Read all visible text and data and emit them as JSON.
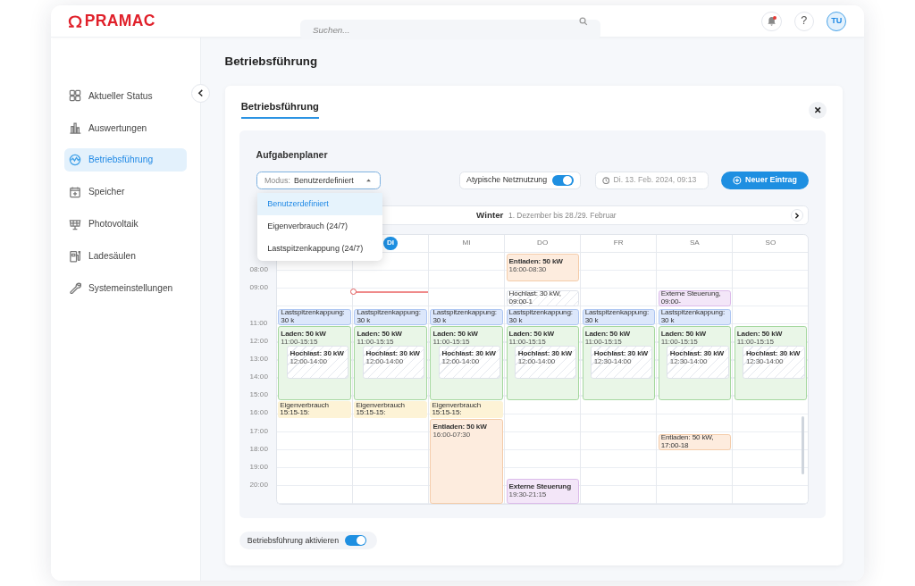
{
  "header": {
    "logo": "PRAMAC",
    "search": {
      "placeholder": "Suchen..."
    },
    "notifications": {
      "unread": true
    },
    "help": "?",
    "avatar": "TU"
  },
  "sidebar": {
    "items": [
      {
        "label": "Aktueller Status",
        "selected": false
      },
      {
        "label": "Auswertungen",
        "selected": false
      },
      {
        "label": "Betriebsführung",
        "selected": true
      },
      {
        "label": "Speicher",
        "selected": false
      },
      {
        "label": "Photovoltaik",
        "selected": false
      },
      {
        "label": "Ladesäulen",
        "selected": false
      },
      {
        "label": "Systemeinstellungen",
        "selected": false
      }
    ]
  },
  "page_title": "Betriebsführung",
  "card": {
    "tabs": [
      {
        "label": "Betriebsführung",
        "selected": true
      }
    ],
    "planner": {
      "title": "Aufgabenplaner",
      "mode": {
        "prefix": "Modus:",
        "value": "Benutzerdefiniert",
        "expanded": true,
        "options": [
          {
            "label": "Benutzerdefiniert",
            "selected": true
          },
          {
            "label": "Eigenverbrauch (24/7)",
            "selected": false
          },
          {
            "label": "Lastspitzenkappung (24/7)",
            "selected": false
          }
        ]
      },
      "atypical": {
        "label": "Atypische Netznutzung",
        "on": true
      },
      "date": {
        "value": "Di. 13. Feb. 2024, 09:13"
      },
      "new_button": "Neuer Eintrag",
      "season": {
        "name": "Winter",
        "range": "1. Dezember bis 28./29. Februar"
      },
      "times": [
        "08:00",
        "09:00",
        "11:00",
        "12:00",
        "13:00",
        "14:00",
        "15:00",
        "16:00",
        "17:00",
        "18:00",
        "19:00",
        "20:00"
      ],
      "days": [
        {
          "today": false,
          "events": [
            {
              "kind": "peak-cap",
              "title": "Lastspitzenkappung: 30 k"
            },
            {
              "kind": "charge",
              "title": "Laden: 50 kW",
              "time": "11:00-15:15",
              "children": [
                {
                  "kind": "peak",
                  "title": "Hochlast: 30 kW",
                  "time": "12:00-14:00"
                }
              ]
            },
            {
              "kind": "self",
              "title": "Eigenverbrauch",
              "time": "15:15-15:"
            }
          ]
        },
        {
          "label": "DI",
          "today": true,
          "events": [
            {
              "kind": "peak-cap",
              "title": "Lastspitzenkappung: 30 k"
            },
            {
              "kind": "charge",
              "title": "Laden: 50 kW",
              "time": "11:00-15:15",
              "children": [
                {
                  "kind": "peak",
                  "title": "Hochlast: 30 kW",
                  "time": "12:00-14:00"
                }
              ]
            },
            {
              "kind": "self",
              "title": "Eigenverbrauch",
              "time": "15:15-15:"
            }
          ]
        },
        {
          "label": "MI",
          "today": false,
          "events": [
            {
              "kind": "peak-cap",
              "title": "Lastspitzenkappung: 30 k"
            },
            {
              "kind": "charge",
              "title": "Laden: 50 kW",
              "time": "11:00-15:15",
              "children": [
                {
                  "kind": "peak",
                  "title": "Hochlast: 30 kW",
                  "time": "12:00-14:00"
                }
              ]
            },
            {
              "kind": "self",
              "title": "Eigenverbrauch",
              "time": "15:15-15:"
            },
            {
              "kind": "discharge",
              "title": "Entladen: 50 kW",
              "time": "16:00-07:30"
            }
          ]
        },
        {
          "label": "DO",
          "today": false,
          "events": [
            {
              "kind": "discharge",
              "title": "Entladen: 50 kW",
              "time": "16:00-08:30"
            },
            {
              "kind": "peak",
              "title": "Hochlast: 30 kW,",
              "time": "09:00-1"
            },
            {
              "kind": "peak-cap",
              "title": "Lastspitzenkappung: 30 k"
            },
            {
              "kind": "charge",
              "title": "Laden: 50 kW",
              "time": "11:00-15:15",
              "children": [
                {
                  "kind": "peak",
                  "title": "Hochlast: 30 kW",
                  "time": "12:00-14:00"
                }
              ]
            },
            {
              "kind": "external",
              "title": "Externe Steuerung",
              "time": "19:30-21:15"
            }
          ]
        },
        {
          "label": "FR",
          "today": false,
          "events": [
            {
              "kind": "peak-cap",
              "title": "Lastspitzenkappung: 30 k"
            },
            {
              "kind": "charge",
              "title": "Laden: 50 kW",
              "time": "11:00-15:15",
              "children": [
                {
                  "kind": "peak",
                  "title": "Hochlast: 30 kW",
                  "time": "12:30-14:00"
                }
              ]
            }
          ]
        },
        {
          "label": "SA",
          "today": false,
          "events": [
            {
              "kind": "external",
              "title": "Externe Steuerung,",
              "time": "09:00-"
            },
            {
              "kind": "peak-cap",
              "title": "Lastspitzenkappung: 30 k"
            },
            {
              "kind": "charge",
              "title": "Laden: 50 kW",
              "time": "11:00-15:15",
              "children": [
                {
                  "kind": "peak",
                  "title": "Hochlast: 30 kW",
                  "time": "12:30-14:00"
                }
              ]
            },
            {
              "kind": "discharge",
              "title": "Entladen: 50 kW,",
              "time": "17:00-18"
            }
          ]
        },
        {
          "label": "SO",
          "today": false,
          "events": [
            {
              "kind": "charge",
              "title": "Laden: 50 kW",
              "time": "11:00-15:15",
              "children": [
                {
                  "kind": "peak",
                  "title": "Hochlast: 30 kW",
                  "time": "12:30-14:00"
                }
              ]
            }
          ]
        }
      ]
    },
    "activate": {
      "label": "Betriebsführung aktivieren",
      "on": true
    }
  }
}
